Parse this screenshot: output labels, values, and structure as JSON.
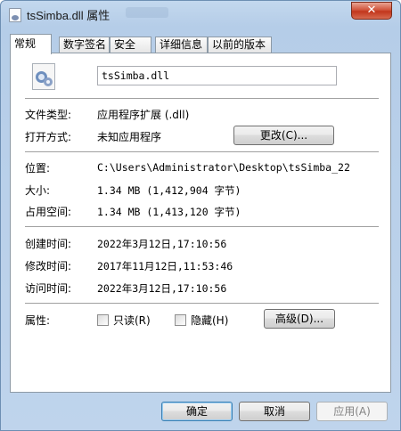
{
  "window": {
    "title": "tsSimba.dll 属性",
    "close_label": "✕"
  },
  "tabs": [
    {
      "label": "常规",
      "active": true
    },
    {
      "label": "数字签名",
      "active": false
    },
    {
      "label": "安全",
      "active": false
    },
    {
      "label": "详细信息",
      "active": false
    },
    {
      "label": "以前的版本",
      "active": false
    }
  ],
  "general": {
    "file_icon": "dll-gear-icon",
    "file_name": "tsSimba.dll",
    "file_type_label": "文件类型:",
    "file_type_value": "应用程序扩展 (.dll)",
    "open_with_label": "打开方式:",
    "open_with_value": "未知应用程序",
    "change_button": "更改(C)...",
    "location_label": "位置:",
    "location_value": "C:\\Users\\Administrator\\Desktop\\tsSimba_22",
    "size_label": "大小:",
    "size_value": "1.34 MB (1,412,904 字节)",
    "disk_size_label": "占用空间:",
    "disk_size_value": "1.34 MB (1,413,120 字节)",
    "created_label": "创建时间:",
    "created_value": "2022年3月12日,17:10:56",
    "modified_label": "修改时间:",
    "modified_value": "2017年11月12日,11:53:46",
    "accessed_label": "访问时间:",
    "accessed_value": "2022年3月12日,17:10:56",
    "attributes_label": "属性:",
    "readonly_label": "只读(R)",
    "hidden_label": "隐藏(H)",
    "advanced_button": "高级(D)..."
  },
  "footer": {
    "ok_button": "确定",
    "cancel_button": "取消",
    "apply_button": "应用(A)"
  }
}
